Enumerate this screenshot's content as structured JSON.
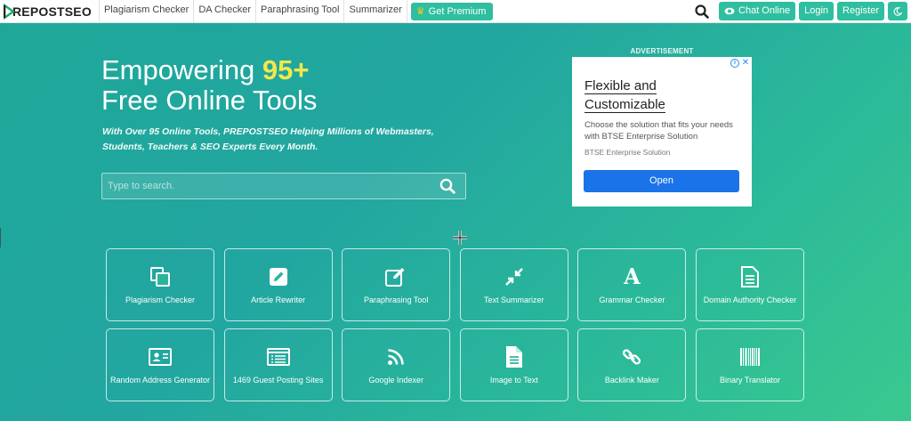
{
  "brand": {
    "logo_text": "REPOSTSEO",
    "colors": {
      "accent": "#2fbfa0",
      "highlight": "#f4e74a",
      "ad_button": "#1a73e8"
    }
  },
  "nav": {
    "links": [
      "Plagiarism Checker",
      "DA Checker",
      "Paraphrasing Tool",
      "Summarizer"
    ],
    "premium_label": "Get Premium",
    "chat_label": "Chat Online",
    "login_label": "Login",
    "register_label": "Register"
  },
  "hero": {
    "title_prefix": "Empowering ",
    "title_highlight": "95+",
    "title_line2": "Free Online Tools",
    "subtitle": "With Over 95 Online Tools, PREPOSTSEO Helping Millions of Webmasters, Students, Teachers & SEO Experts Every Month."
  },
  "search": {
    "placeholder": "Type to search."
  },
  "ad": {
    "label": "ADVERTISEMENT",
    "headline_line1": "Flexible and",
    "headline_line2": "Customizable",
    "body": "Choose the solution that fits your needs with BTSE Enterprise Solution",
    "source": "BTSE Enterprise Solution",
    "button": "Open"
  },
  "tools": [
    {
      "label": "Plagiarism Checker",
      "icon": "copy-icon"
    },
    {
      "label": "Article Rewriter",
      "icon": "edit-icon"
    },
    {
      "label": "Paraphrasing Tool",
      "icon": "pen-square-icon"
    },
    {
      "label": "Text Summarizer",
      "icon": "compress-icon"
    },
    {
      "label": "Grammar Checker",
      "icon": "font-icon"
    },
    {
      "label": "Domain Authority Checker",
      "icon": "file-text-icon"
    },
    {
      "label": "Random Address Generator",
      "icon": "address-card-icon"
    },
    {
      "label": "1469 Guest Posting Sites",
      "icon": "list-window-icon"
    },
    {
      "label": "Google Indexer",
      "icon": "rss-icon"
    },
    {
      "label": "Image to Text",
      "icon": "file-alt-icon"
    },
    {
      "label": "Backlink Maker",
      "icon": "link-icon"
    },
    {
      "label": "Binary Translator",
      "icon": "barcode-icon"
    }
  ]
}
